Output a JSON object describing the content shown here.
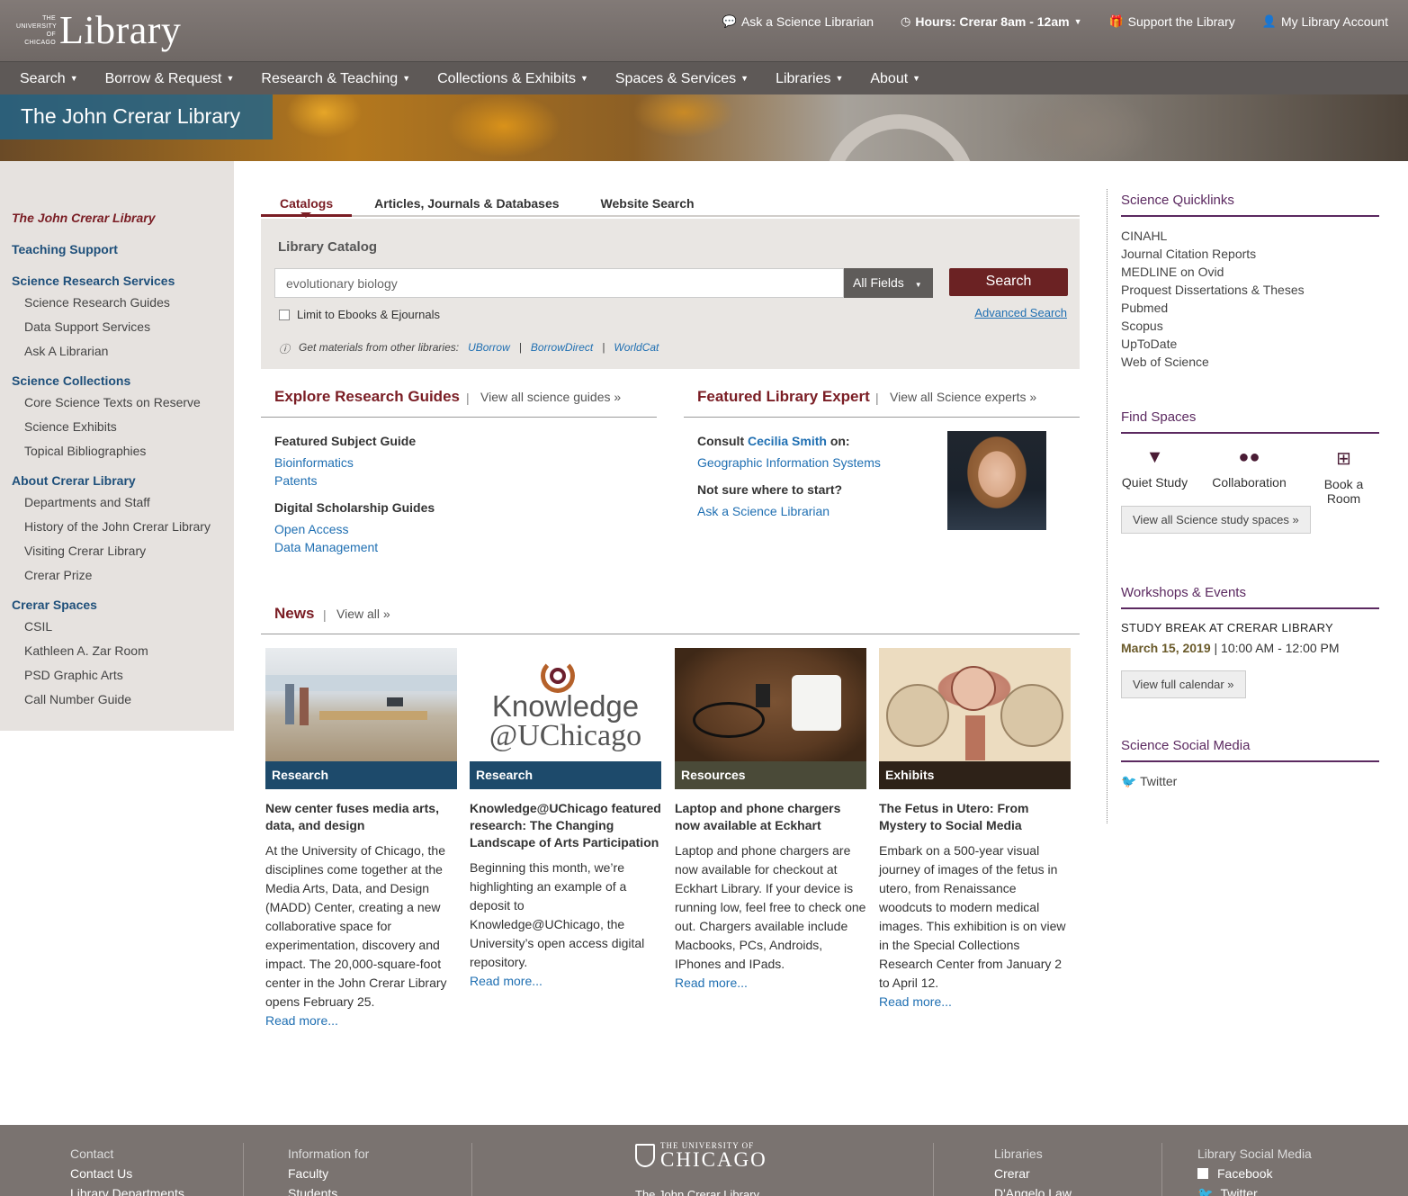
{
  "header": {
    "logo_small": "THE UNIVERSITY OF CHICAGO",
    "logo_big": "Library",
    "links": [
      {
        "label": "Ask a Science Librarian",
        "icon": "chat-icon"
      },
      {
        "label": "Hours: Crerar  8am - 12am",
        "icon": "clock-icon"
      },
      {
        "label": "Support the Library",
        "icon": "gift-icon"
      },
      {
        "label": "My Library Account",
        "icon": "user-icon"
      }
    ]
  },
  "nav": [
    "Search",
    "Borrow & Request",
    "Research & Teaching",
    "Collections & Exhibits",
    "Spaces & Services",
    "Libraries",
    "About"
  ],
  "banner_title": "The John Crerar Library",
  "leftnav": {
    "current": "The John Crerar Library",
    "teaching": "Teaching Support",
    "groups": [
      {
        "title": "Science Research Services",
        "items": [
          "Science Research Guides",
          "Data Support Services",
          "Ask A Librarian"
        ]
      },
      {
        "title": "Science Collections",
        "items": [
          "Core Science Texts on Reserve",
          "Science Exhibits",
          "Topical Bibliographies"
        ]
      },
      {
        "title": "About Crerar Library",
        "items": [
          "Departments and Staff",
          "History of the John Crerar Library",
          "Visiting Crerar Library",
          "Crerar Prize"
        ]
      },
      {
        "title": "Crerar Spaces",
        "items": [
          "CSIL",
          "Kathleen A. Zar Room",
          "PSD Graphic Arts",
          "Call Number Guide"
        ]
      }
    ]
  },
  "search": {
    "tabs": [
      "Catalogs",
      "Articles, Journals & Databases",
      "Website Search"
    ],
    "heading": "Library Catalog",
    "placeholder": "evolutionary biology",
    "fields": "All Fields",
    "button": "Search",
    "limit": "Limit to Ebooks & Ejournals",
    "advanced": "Advanced Search",
    "other": "Get materials from other libraries:",
    "other_links": [
      "UBorrow",
      "BorrowDirect",
      "WorldCat"
    ]
  },
  "guides": {
    "title": "Explore Research Guides",
    "view": "View all science guides »",
    "featured": "Featured Subject Guide",
    "featured_links": [
      "Bioinformatics",
      "Patents"
    ],
    "digital": "Digital Scholarship Guides",
    "digital_links": [
      "Open Access",
      "Data Management"
    ]
  },
  "expert": {
    "title": "Featured Library Expert",
    "view": "View all Science experts »",
    "consult": "Consult",
    "name": "Cecilia Smith",
    "on": "on:",
    "topic": "Geographic Information Systems",
    "not_sure": "Not sure where to start?",
    "ask": "Ask a Science Librarian"
  },
  "news": {
    "title": "News",
    "view": "View all »",
    "items": [
      {
        "cat": "Research",
        "color": "#1d4a6b",
        "head": "New center fuses media arts, data, and design",
        "body": "At the University of Chicago, the disciplines come together at the Media Arts, Data, and Design (MADD) Center, creating a new collaborative space for experimentation, discovery and impact. The 20,000-square-foot center in the John Crerar Library opens February 25.",
        "more": "Read more..."
      },
      {
        "cat": "Research",
        "color": "#1d4a6b",
        "head": "Knowledge@UChicago featured research: The Changing Landscape of Arts Participation",
        "body": "Beginning this month, we’re highlighting an example of a deposit to Knowledge@UChicago, the University’s open access digital repository.",
        "more": "Read more...",
        "logo1": "Knowledge",
        "logo2": "@UChicago"
      },
      {
        "cat": "Resources",
        "color": "#4a4a38",
        "head": "Laptop and phone chargers now available at Eckhart",
        "body": "Laptop and phone chargers are now available for checkout at Eckhart Library. If your device is running low, feel free to check one out. Chargers available include Macbooks, PCs, Androids, IPhones and IPads.",
        "more": "Read more..."
      },
      {
        "cat": "Exhibits",
        "color": "#2e2218",
        "head": "The Fetus in Utero: From Mystery to Social Media",
        "body": "Embark on a 500-year visual journey of images of the fetus in utero, from Renaissance woodcuts to modern medical images. This exhibition is on view in the Special Collections Research Center from January 2 to April 12.",
        "more": "Read more..."
      }
    ]
  },
  "right": {
    "quick_title": "Science Quicklinks",
    "quick": [
      "CINAHL",
      "Journal Citation Reports",
      "MEDLINE on Ovid",
      "Proquest Dissertations & Theses",
      "Pubmed",
      "Scopus",
      "UpToDate",
      "Web of Science"
    ],
    "spaces_title": "Find Spaces",
    "spaces": [
      {
        "label": "Quiet Study",
        "icon": "book-reader-icon"
      },
      {
        "label": "Collaboration",
        "icon": "people-icon"
      },
      {
        "label": "Book a Room",
        "icon": "calendar-plus-icon"
      }
    ],
    "spaces_btn": "View all Science study spaces »",
    "events_title": "Workshops & Events",
    "event_name": "STUDY BREAK AT CRERAR LIBRARY",
    "event_date": "March 15, 2019",
    "event_time": "| 10:00 AM - 12:00 PM",
    "events_btn": "View full calendar »",
    "social_title": "Science Social Media",
    "twitter": "Twitter"
  },
  "footer": {
    "col1": [
      "Contact",
      "Contact Us",
      "Library Departments"
    ],
    "col2": [
      "Information for",
      "Faculty",
      "Students"
    ],
    "uc_small": "THE UNIVERSITY OF",
    "uc_big": "CHICAGO",
    "uc_sub": "The John Crerar Library",
    "col4": [
      "Libraries",
      "Crerar",
      "D'Angelo Law"
    ],
    "col5": [
      "Library Social Media",
      "Facebook",
      "Twitter"
    ]
  }
}
